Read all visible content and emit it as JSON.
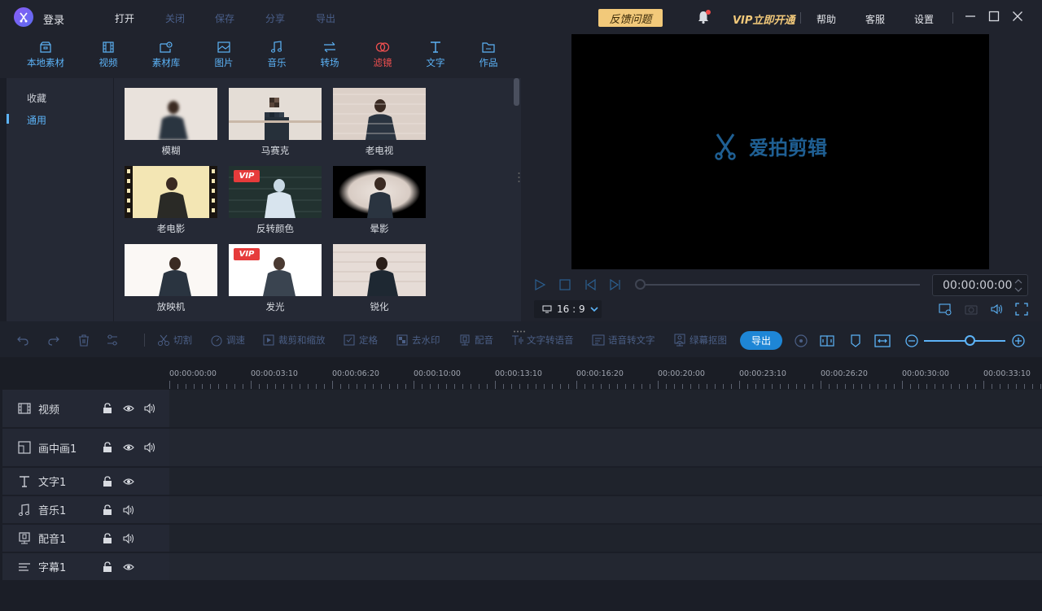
{
  "titlebar": {
    "login": "登录",
    "menus": [
      {
        "label": "打开",
        "enabled": true
      },
      {
        "label": "关闭",
        "enabled": false
      },
      {
        "label": "保存",
        "enabled": false
      },
      {
        "label": "分享",
        "enabled": false
      },
      {
        "label": "导出",
        "enabled": false
      }
    ],
    "feedback": "反馈问题",
    "vip": "VIP立即开通",
    "help": "帮助",
    "service": "客服",
    "settings": "设置"
  },
  "categories": [
    {
      "label": "本地素材",
      "icon": "local-media-icon"
    },
    {
      "label": "视频",
      "icon": "video-icon"
    },
    {
      "label": "素材库",
      "icon": "library-icon"
    },
    {
      "label": "图片",
      "icon": "image-icon"
    },
    {
      "label": "音乐",
      "icon": "music-icon"
    },
    {
      "label": "转场",
      "icon": "transition-icon"
    },
    {
      "label": "滤镜",
      "icon": "filter-icon",
      "active": true
    },
    {
      "label": "文字",
      "icon": "text-icon"
    },
    {
      "label": "作品",
      "icon": "works-icon"
    }
  ],
  "sidebar": {
    "favorites": "收藏",
    "common": "通用"
  },
  "filters": [
    {
      "label": "模糊",
      "vip": false
    },
    {
      "label": "马赛克",
      "vip": false
    },
    {
      "label": "老电视",
      "vip": false
    },
    {
      "label": "老电影",
      "vip": false
    },
    {
      "label": "反转颜色",
      "vip": true
    },
    {
      "label": "晕影",
      "vip": false
    },
    {
      "label": "放映机",
      "vip": false
    },
    {
      "label": "发光",
      "vip": true
    },
    {
      "label": "锐化",
      "vip": false
    }
  ],
  "vip_badge": "VIP",
  "preview": {
    "brand": "爱拍剪辑",
    "timecode": "00:00:00:00",
    "ratio": "16 : 9"
  },
  "edit_tools": [
    {
      "label": "切割",
      "icon": "scissors-icon"
    },
    {
      "label": "调速",
      "icon": "speed-icon"
    },
    {
      "label": "裁剪和缩放",
      "icon": "crop-icon"
    },
    {
      "label": "定格",
      "icon": "freeze-icon"
    },
    {
      "label": "去水印",
      "icon": "watermark-icon"
    },
    {
      "label": "配音",
      "icon": "dub-icon"
    },
    {
      "label": "文字转语音",
      "icon": "tts-icon"
    },
    {
      "label": "语音转文字",
      "icon": "stt-icon"
    },
    {
      "label": "绿幕抠图",
      "icon": "greenscreen-icon"
    }
  ],
  "export_label": "导出",
  "timeline": {
    "ticks": [
      "00:00:00:00",
      "00:00:03:10",
      "00:00:06:20",
      "00:00:10:00",
      "00:00:13:10",
      "00:00:16:20",
      "00:00:20:00",
      "00:00:23:10",
      "00:00:26:20",
      "00:00:30:00",
      "00:00:33:10"
    ],
    "tracks": [
      {
        "name": "视频",
        "icon": "film-icon",
        "eye": true,
        "audio": true
      },
      {
        "name": "画中画1",
        "icon": "pip-icon",
        "eye": true,
        "audio": true
      },
      {
        "name": "文字1",
        "icon": "text-track-icon",
        "eye": true,
        "audio": false
      },
      {
        "name": "音乐1",
        "icon": "music-track-icon",
        "eye": false,
        "audio": true
      },
      {
        "name": "配音1",
        "icon": "mic-track-icon",
        "eye": false,
        "audio": true
      },
      {
        "name": "字幕1",
        "icon": "subtitle-track-icon",
        "eye": true,
        "audio": false
      }
    ]
  },
  "colors": {
    "accent": "#5cb3f7",
    "active_category": "#f25050",
    "export": "#1e86d6",
    "vip_gold": "#f2c97a"
  }
}
